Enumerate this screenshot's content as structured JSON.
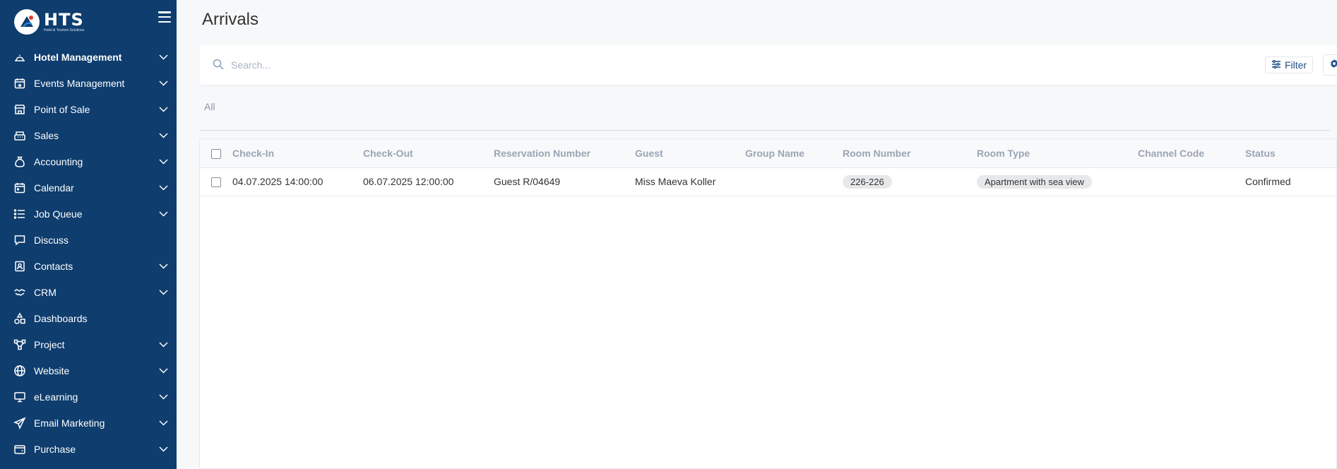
{
  "brand": {
    "name": "HTS",
    "tagline": "Hotel & Tourism Solutions"
  },
  "sidebar": {
    "items": [
      {
        "label": "Hotel Management",
        "icon": "bell-icon",
        "active": true,
        "expandable": true
      },
      {
        "label": "Events Management",
        "icon": "calendar-star-icon",
        "expandable": true
      },
      {
        "label": "Point of Sale",
        "icon": "store-icon",
        "expandable": true
      },
      {
        "label": "Sales",
        "icon": "register-icon",
        "expandable": true
      },
      {
        "label": "Accounting",
        "icon": "money-bag-icon",
        "expandable": true
      },
      {
        "label": "Calendar",
        "icon": "calendar-icon",
        "expandable": true
      },
      {
        "label": "Job Queue",
        "icon": "list-icon",
        "expandable": true
      },
      {
        "label": "Discuss",
        "icon": "chat-icon",
        "expandable": false
      },
      {
        "label": "Contacts",
        "icon": "contact-card-icon",
        "expandable": true
      },
      {
        "label": "CRM",
        "icon": "handshake-icon",
        "expandable": true
      },
      {
        "label": "Dashboards",
        "icon": "shapes-icon",
        "expandable": false
      },
      {
        "label": "Project",
        "icon": "network-icon",
        "expandable": true
      },
      {
        "label": "Website",
        "icon": "globe-icon",
        "expandable": true
      },
      {
        "label": "eLearning",
        "icon": "monitor-icon",
        "expandable": true
      },
      {
        "label": "Email Marketing",
        "icon": "paper-plane-icon",
        "expandable": true
      },
      {
        "label": "Purchase",
        "icon": "wallet-icon",
        "expandable": true
      }
    ]
  },
  "page": {
    "title": "Arrivals"
  },
  "search": {
    "placeholder": "Search...",
    "value": ""
  },
  "toolbar": {
    "filter_label": "Filter"
  },
  "tabs": {
    "all_label": "All"
  },
  "table": {
    "columns": [
      "Check-In",
      "Check-Out",
      "Reservation Number",
      "Guest",
      "Group Name",
      "Room Number",
      "Room Type",
      "Channel Code",
      "Status"
    ],
    "rows": [
      {
        "check_in": "04.07.2025 14:00:00",
        "check_out": "06.07.2025 12:00:00",
        "reservation_number": "Guest R/04649",
        "guest": "Miss Maeva Koller",
        "group_name": "",
        "room_number": "226-226",
        "room_type": "Apartment with sea view",
        "channel_code": "",
        "status": "Confirmed"
      }
    ]
  },
  "colors": {
    "sidebar_bg": "#0e3d6e",
    "accent": "#1f4f86",
    "background": "#f7f8fa"
  }
}
